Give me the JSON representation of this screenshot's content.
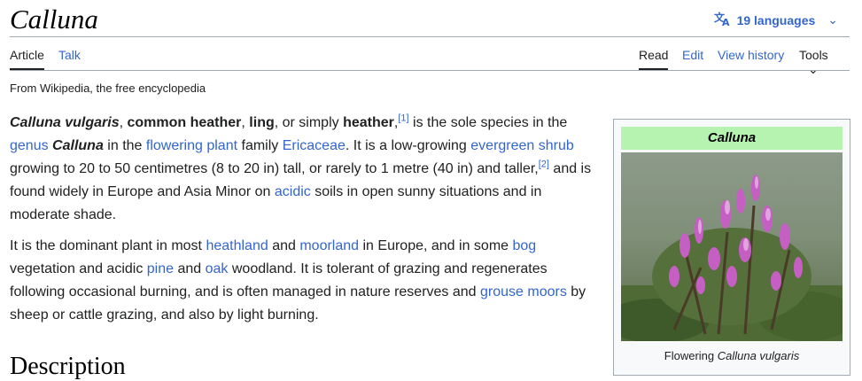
{
  "page": {
    "title": "Calluna",
    "tagline": "From Wikipedia, the free encyclopedia"
  },
  "lang": {
    "label": "19 languages",
    "icon": "translate-icon"
  },
  "tabs": {
    "left": [
      "Article",
      "Talk"
    ],
    "right": [
      "Read",
      "Edit",
      "View history",
      "Tools"
    ]
  },
  "p1": {
    "a1": "Calluna vulgaris",
    "a2": ", ",
    "a3": "common heather",
    "a4": ", ",
    "a5": "ling",
    "a6": ", or simply ",
    "a7": "heather",
    "a8": ",",
    "a9": "[1]",
    "a10": " is the sole species in the ",
    "a11": "genus",
    "a12": " ",
    "a13": "Calluna",
    "a14": " in the ",
    "a15": "flowering plant",
    "a16": " family ",
    "a17": "Ericaceae",
    "a18": ". It is a low-growing ",
    "a19": "evergreen shrub",
    "a20": " growing to 20 to 50 centimetres (8 to 20 in) tall, or rarely to 1 metre (40 in) and taller,",
    "a21": "[2]",
    "a22": " and is found widely in Europe and Asia Minor on ",
    "a23": "acidic",
    "a24": " soils in open sunny situations and in moderate shade."
  },
  "p2": {
    "b1": "It is the dominant plant in most ",
    "b2": "heathland",
    "b3": " and ",
    "b4": "moorland",
    "b5": " in Europe, and in some ",
    "b6": "bog",
    "b7": " vegetation and acidic ",
    "b8": "pine",
    "b9": " and ",
    "b10": "oak",
    "b11": " woodland. It is tolerant of grazing and regenerates following occasional burning, and is often managed in nature reserves and ",
    "b12": "grouse moors",
    "b13": " by sheep or cattle grazing, and also by light burning."
  },
  "heading": "Description",
  "infobox": {
    "title": "Calluna",
    "caption_pre": "Flowering ",
    "caption_em": "Calluna vulgaris"
  },
  "colors": {
    "link": "#3366cc",
    "infobox_header": "#b6f2b0"
  }
}
